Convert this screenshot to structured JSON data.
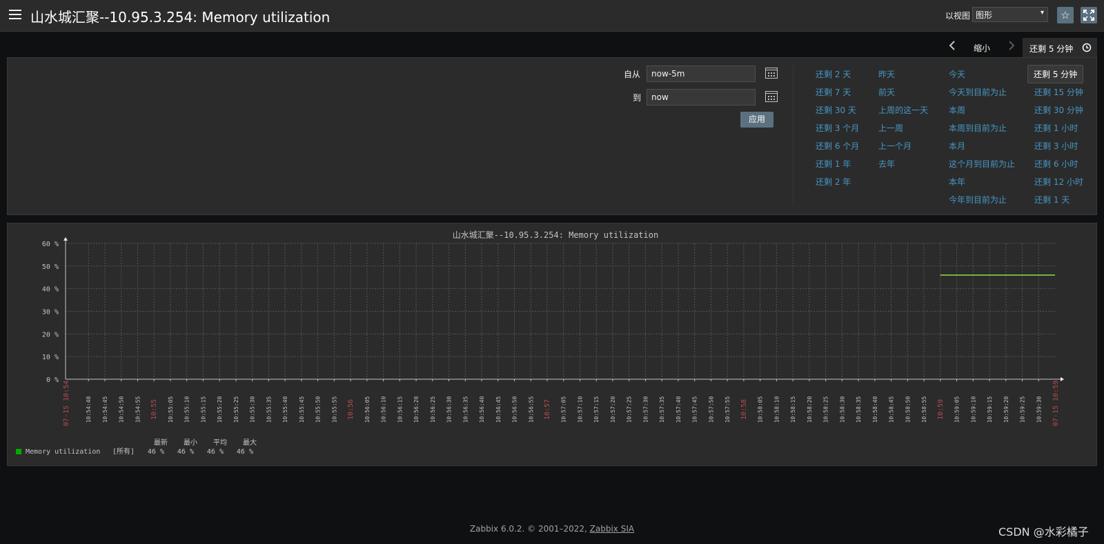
{
  "header": {
    "title": "山水城汇聚--10.95.3.254: Memory utilization",
    "view_label": "以视图",
    "view_select": "图形",
    "favorite_icon": "star-icon",
    "fullscreen_icon": "expand-icon"
  },
  "time_nav": {
    "zoom_out": "缩小",
    "active_tab": "还剩 5 分钟",
    "clock_icon": "clock-icon"
  },
  "filter": {
    "from_label": "自从",
    "from_value": "now-5m",
    "to_label": "到",
    "to_value": "now",
    "apply_label": "应用"
  },
  "quick_ranges": {
    "col1": [
      "还剩 2 天",
      "还剩 7 天",
      "还剩 30 天",
      "还剩 3 个月",
      "还剩 6 个月",
      "还剩 1 年",
      "还剩 2 年"
    ],
    "col2": [
      "昨天",
      "前天",
      "上周的这一天",
      "上一周",
      "上一个月",
      "去年"
    ],
    "col3": [
      "今天",
      "今天到目前为止",
      "本周",
      "本周到目前为止",
      "本月",
      "这个月到目前为止",
      "本年",
      "今年到目前为止"
    ],
    "col4": [
      "还剩 5 分钟",
      "还剩 15 分钟",
      "还剩 30 分钟",
      "还剩 1 小时",
      "还剩 3 小时",
      "还剩 6 小时",
      "还剩 12 小时",
      "还剩 1 天"
    ]
  },
  "graph": {
    "colors": {
      "series": "#8ee04a",
      "legend_swatch": "#00aa00",
      "major_tick": "#b84b4b",
      "tick": "#c4c4c4",
      "grid": "#555555"
    },
    "legend": {
      "headers": [
        "最新",
        "最小",
        "平均",
        "最大"
      ],
      "name": "Memory utilization",
      "func": "[所有]",
      "values": [
        "46 %",
        "46 %",
        "46 %",
        "46 %"
      ]
    }
  },
  "chart_data": {
    "type": "line",
    "title": "山水城汇聚--10.95.3.254: Memory utilization",
    "ylim": [
      0,
      60
    ],
    "y_ticks": [
      "0 %",
      "10 %",
      "20 %",
      "30 %",
      "40 %",
      "50 %",
      "60 %"
    ],
    "x_start_label": "07-15 10:54",
    "x_end_label": "07-15 10:59",
    "x_tick_labels": [
      "10:54:40",
      "10:54:45",
      "10:54:50",
      "10:54:55",
      "10:55",
      "10:55:05",
      "10:55:10",
      "10:55:15",
      "10:55:20",
      "10:55:25",
      "10:55:30",
      "10:55:35",
      "10:55:40",
      "10:55:45",
      "10:55:50",
      "10:55:55",
      "10:56",
      "10:56:05",
      "10:56:10",
      "10:56:15",
      "10:56:20",
      "10:56:25",
      "10:56:30",
      "10:56:35",
      "10:56:40",
      "10:56:45",
      "10:56:50",
      "10:56:55",
      "10:57",
      "10:57:05",
      "10:57:10",
      "10:57:15",
      "10:57:20",
      "10:57:25",
      "10:57:30",
      "10:57:35",
      "10:57:40",
      "10:57:45",
      "10:57:50",
      "10:57:55",
      "10:58",
      "10:58:05",
      "10:58:10",
      "10:58:15",
      "10:58:20",
      "10:58:25",
      "10:58:30",
      "10:58:35",
      "10:58:40",
      "10:58:45",
      "10:58:50",
      "10:58:55",
      "10:59",
      "10:59:05",
      "10:59:10",
      "10:59:15",
      "10:59:20",
      "10:59:25",
      "10:59:30"
    ],
    "major_ticks": [
      "10:55",
      "10:56",
      "10:57",
      "10:58",
      "10:59"
    ],
    "grid": true,
    "series": [
      {
        "name": "Memory utilization",
        "x": [
          "10:59",
          "10:59:35"
        ],
        "values": [
          46,
          46
        ]
      }
    ]
  },
  "footer": {
    "text": "Zabbix 6.0.2. © 2001–2022, ",
    "link": "Zabbix SIA"
  },
  "watermark": "CSDN @水彩橘子"
}
